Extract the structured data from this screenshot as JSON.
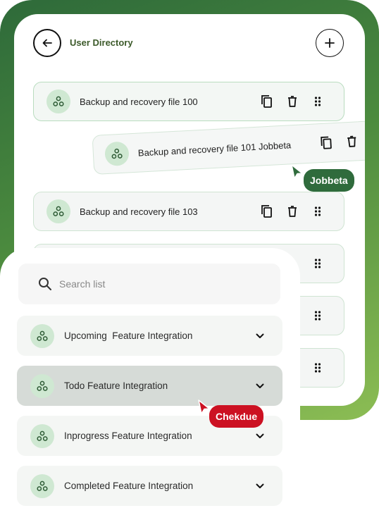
{
  "header": {
    "title": "User Directory",
    "back_icon": "arrow-left-icon",
    "add_icon": "plus-icon"
  },
  "files": [
    {
      "name": "Backup and recovery file 100",
      "icons": [
        "copy-icon",
        "trash-icon",
        "drag-handle-icon"
      ]
    },
    {
      "name": "Backup and recovery file 101 Jobbeta",
      "icons": [
        "copy-icon",
        "trash-icon"
      ]
    },
    {
      "name": "Backup and recovery file 103",
      "icons": [
        "copy-icon",
        "trash-icon",
        "drag-handle-icon"
      ]
    }
  ],
  "cursors": [
    {
      "label": "Jobbeta",
      "color": "#2f6b3c"
    },
    {
      "label": "Chekdue",
      "color": "#cc1122"
    }
  ],
  "search": {
    "placeholder": "Search list"
  },
  "lists": [
    {
      "label": "Upcoming  Feature Integration",
      "highlighted": false
    },
    {
      "label": "Todo Feature Integration",
      "highlighted": true
    },
    {
      "label": "Inprogress Feature Integration",
      "highlighted": false
    },
    {
      "label": "Completed Feature Integration",
      "highlighted": false
    }
  ],
  "colors": {
    "frame_dark": "#2e6a3a",
    "frame_light": "#8cbd54",
    "avatar_bg": "#cfe8d2",
    "accent_green": "#2f6b3c",
    "accent_red": "#cc1122"
  }
}
